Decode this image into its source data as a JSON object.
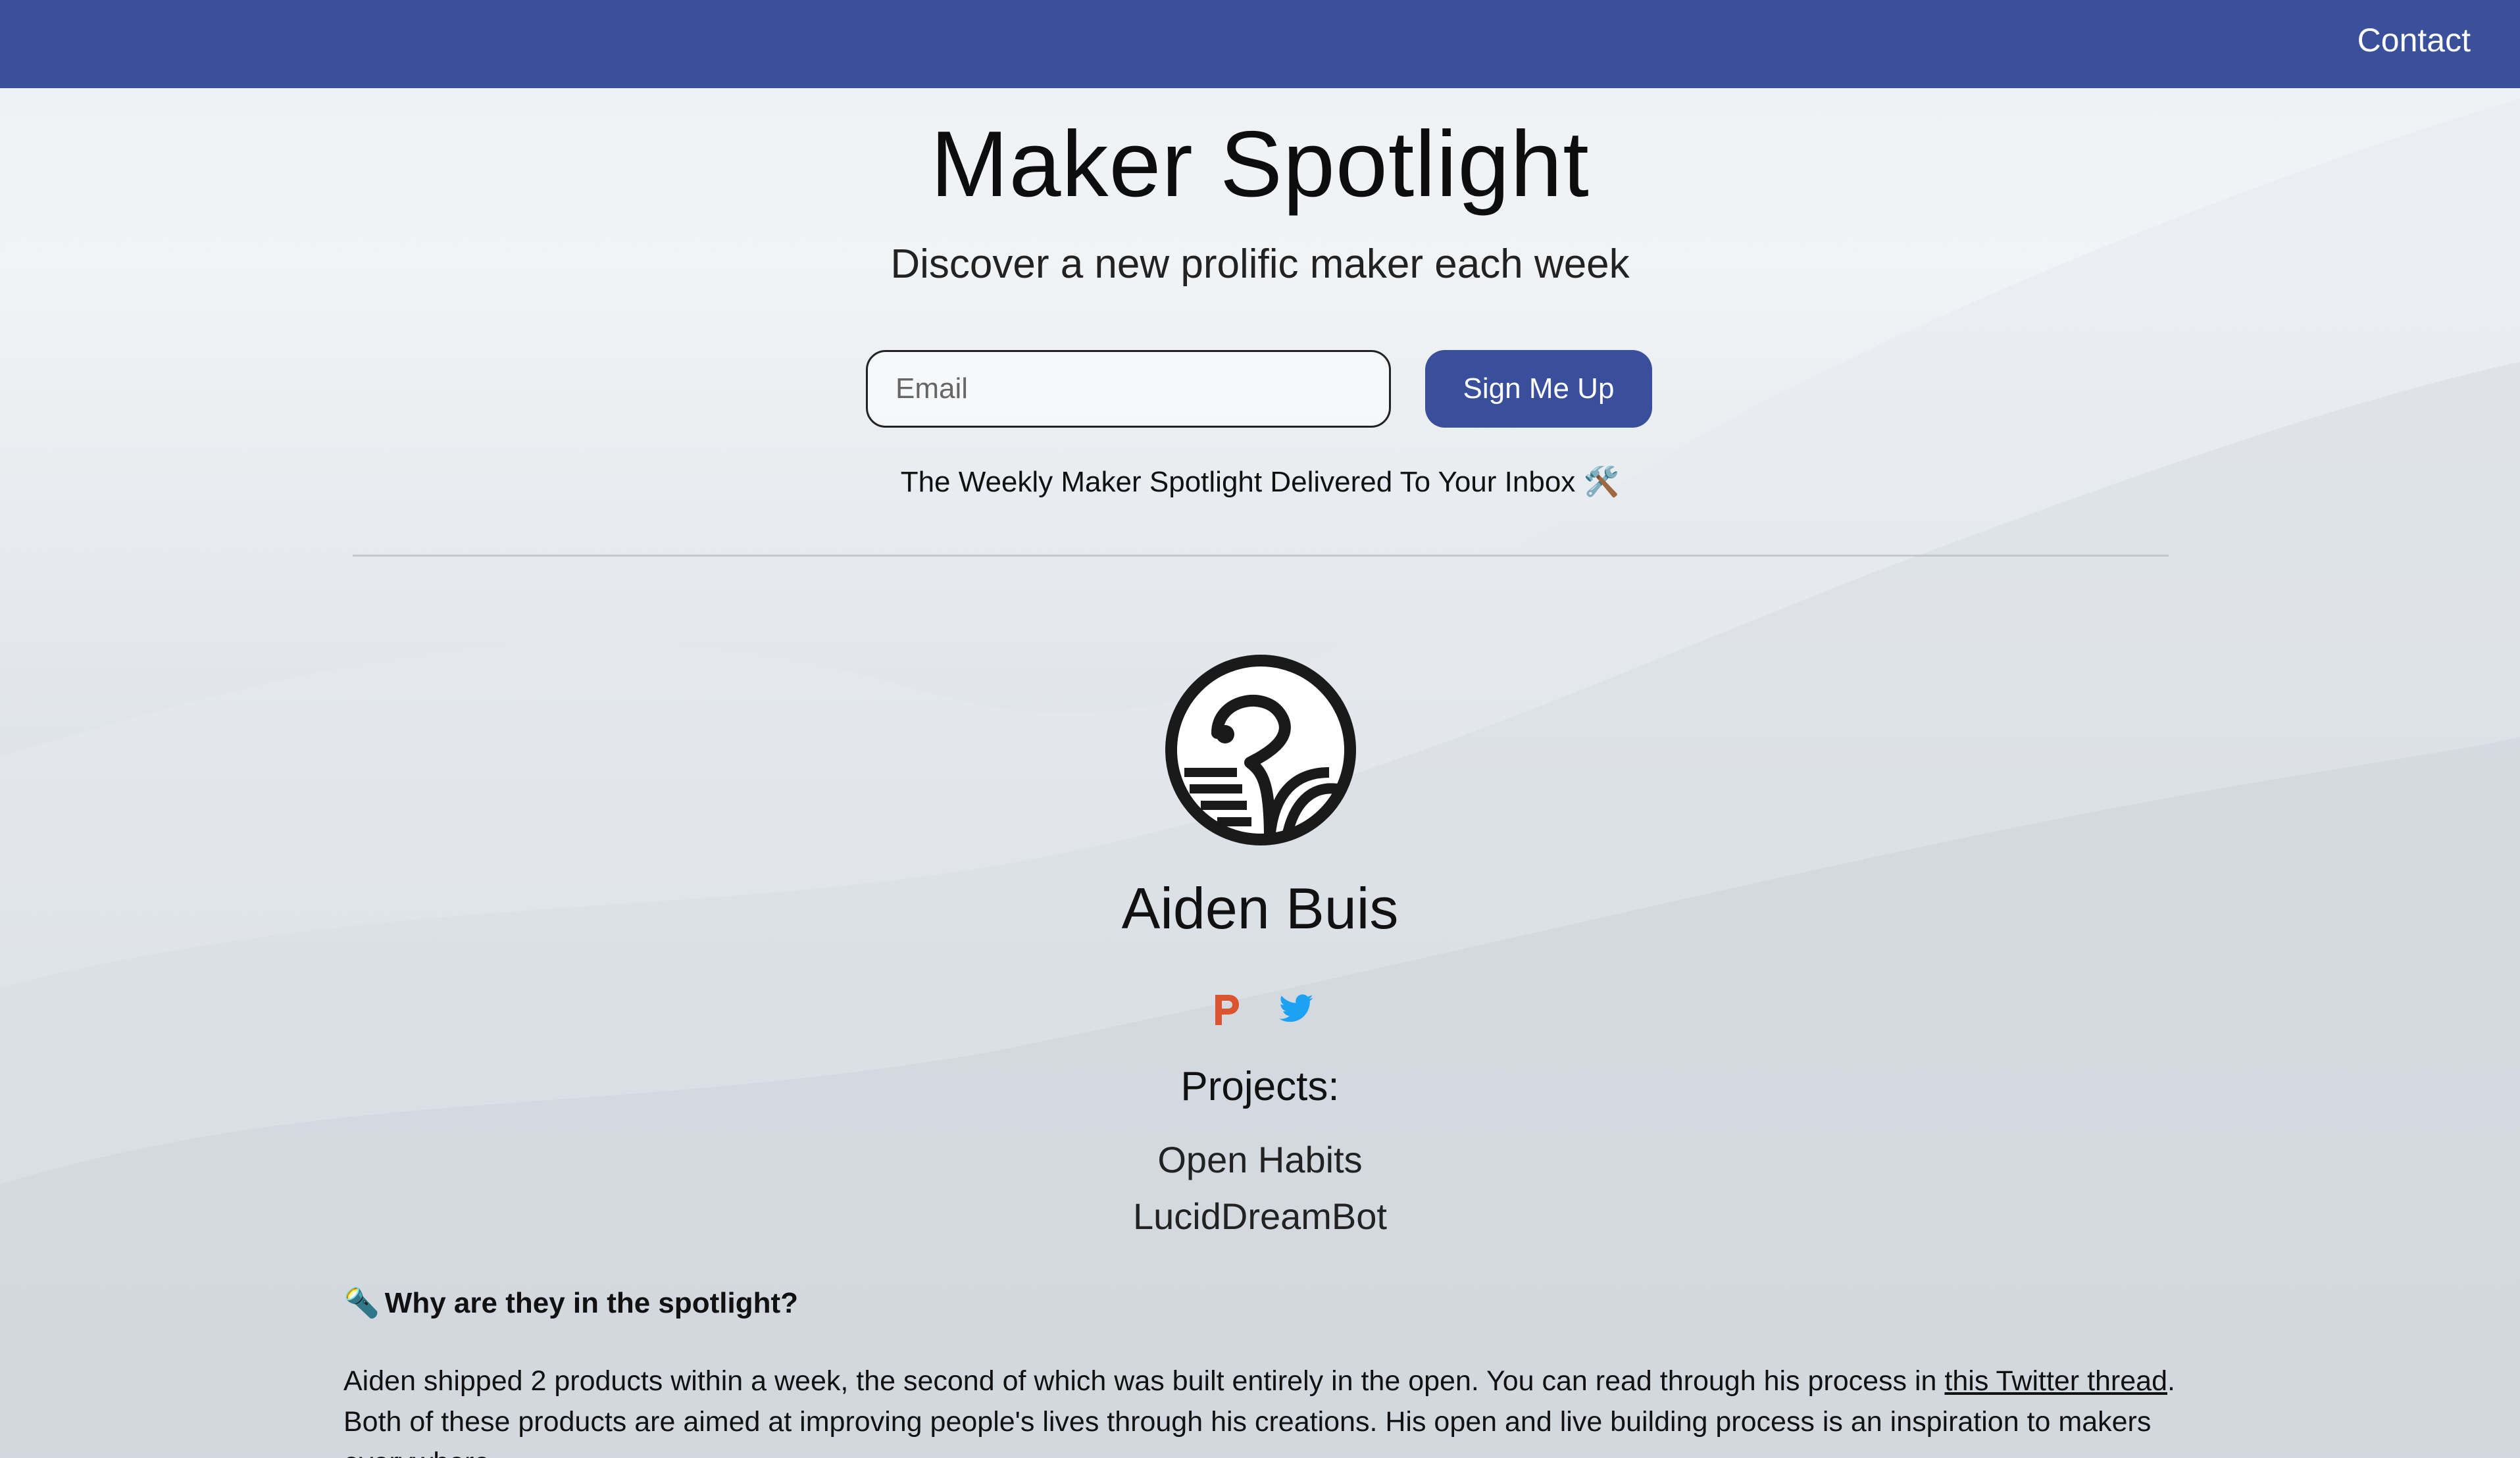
{
  "nav": {
    "contact_label": "Contact"
  },
  "hero": {
    "title": "Maker Spotlight",
    "subtitle": "Discover a new prolific maker each week"
  },
  "signup": {
    "email_placeholder": "Email",
    "button_label": "Sign Me Up",
    "tagline": "The Weekly Maker Spotlight Delivered To Your Inbox 🛠️"
  },
  "maker": {
    "name": "Aiden Buis",
    "projects_heading": "Projects:",
    "projects": [
      "Open Habits",
      "LucidDreamBot"
    ],
    "social_icons": [
      "producthunt-icon",
      "twitter-icon"
    ]
  },
  "spotlight": {
    "heading_emoji": "🔦",
    "heading": "Why are they in the spotlight?",
    "para_part1": "Aiden shipped 2 products within a week, the second of which was built entirely in the open. You can read through his process in ",
    "link_text": "this Twitter thread",
    "para_part2": ". Both of these products are aimed at improving people's lives through his creations. His open and live building process is an inspiration to makers everywhere."
  },
  "colors": {
    "nav_bg": "#3a509b",
    "button_bg": "#3a4f9c",
    "producthunt": "#da552f",
    "twitter": "#1da1f2"
  }
}
